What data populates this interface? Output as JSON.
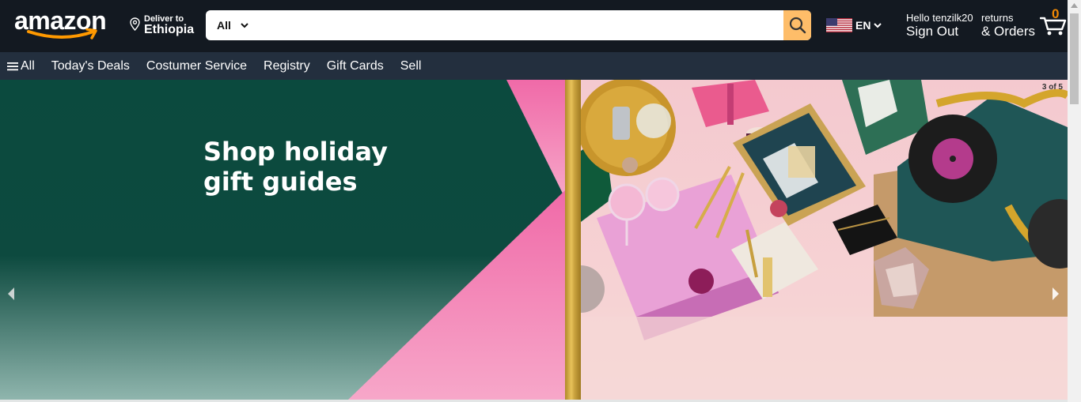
{
  "header": {
    "logo_text": "amazon",
    "deliver_small": "Deliver to",
    "deliver_location": "Ethiopia",
    "search_category": "All",
    "search_placeholder": "",
    "language": "EN",
    "account_greeting": "Hello tenzilk20",
    "account_action": "Sign Out",
    "returns_line1": "returns",
    "returns_line2": "& Orders",
    "cart_count": "0"
  },
  "subnav": {
    "items": [
      "All",
      "Today's Deals",
      "Costumer Service",
      "Registry",
      "Gift Cards",
      "Sell"
    ]
  },
  "hero": {
    "title_line1": "Shop holiday",
    "title_line2": "gift guides",
    "slide_counter": "3 of 5"
  },
  "colors": {
    "nav_top": "#131921",
    "nav_sub": "#232f3e",
    "search_button": "#febd69",
    "cart_count": "#f08804",
    "hero_green": "#0d4a3f",
    "hero_pink": "#f06aa8"
  },
  "icons": [
    "location-pin-icon",
    "chevron-down-icon",
    "search-icon",
    "us-flag-icon",
    "cart-icon",
    "hamburger-icon",
    "arrow-left-icon",
    "arrow-right-icon"
  ]
}
